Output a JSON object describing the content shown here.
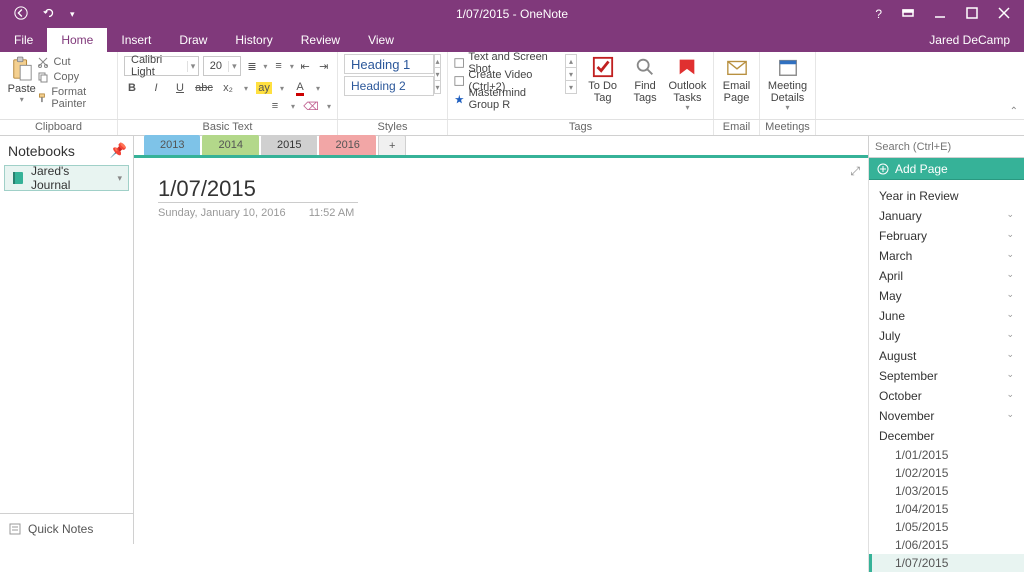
{
  "titlebar": {
    "title": "1/07/2015 - OneNote"
  },
  "username": "Jared DeCamp",
  "menus": {
    "file": "File",
    "home": "Home",
    "insert": "Insert",
    "draw": "Draw",
    "history": "History",
    "review": "Review",
    "view": "View"
  },
  "clipboard": {
    "paste": "Paste",
    "cut": "Cut",
    "copy": "Copy",
    "fp": "Format Painter",
    "label": "Clipboard"
  },
  "basictext": {
    "font": "Calibri Light",
    "size": "20",
    "label": "Basic Text"
  },
  "styles": {
    "h1": "Heading 1",
    "h2": "Heading 2",
    "label": "Styles"
  },
  "tags": {
    "t1": "Text and Screen Shot",
    "t2": "Create Video (Ctrl+2)",
    "t3": "Mastermind Group R",
    "todo": "To Do Tag",
    "find": "Find Tags",
    "outlook": "Outlook Tasks",
    "label": "Tags"
  },
  "email": {
    "btn": "Email Page",
    "label": "Email"
  },
  "meetings": {
    "btn": "Meeting Details",
    "label": "Meetings"
  },
  "notebooks": {
    "header": "Notebooks",
    "current": "Jared's Journal",
    "quick": "Quick Notes"
  },
  "sections": {
    "s1": "2013",
    "s2": "2014",
    "s3": "2015",
    "s4": "2016",
    "add": "+"
  },
  "page": {
    "title": "1/07/2015",
    "date": "Sunday, January 10, 2016",
    "time": "11:52 AM"
  },
  "search": {
    "placeholder": "Search (Ctrl+E)"
  },
  "addpage": "Add Page",
  "pagelist": {
    "yir": "Year in Review",
    "months": [
      "January",
      "February",
      "March",
      "April",
      "May",
      "June",
      "July",
      "August",
      "September",
      "October",
      "November"
    ],
    "december": "December",
    "pages": [
      "1/01/2015",
      "1/02/2015",
      "1/03/2015",
      "1/04/2015",
      "1/05/2015",
      "1/06/2015",
      "1/07/2015"
    ]
  }
}
